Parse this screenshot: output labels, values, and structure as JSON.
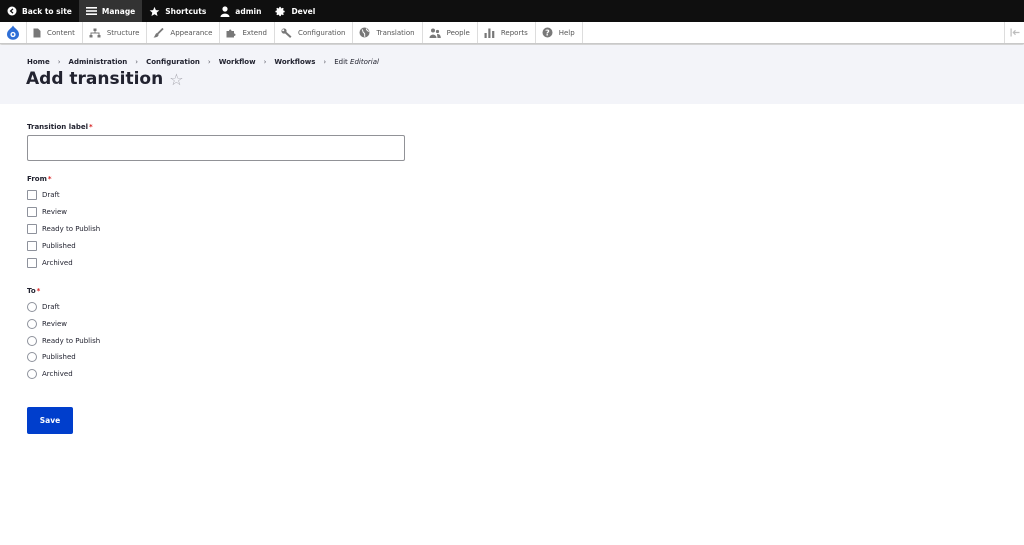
{
  "toolbar": {
    "back_to_site": "Back to site",
    "manage": "Manage",
    "shortcuts": "Shortcuts",
    "user": "admin",
    "devel": "Devel"
  },
  "tray": {
    "items": [
      "Content",
      "Structure",
      "Appearance",
      "Extend",
      "Configuration",
      "Translation",
      "People",
      "Reports",
      "Help"
    ]
  },
  "breadcrumb": {
    "items": [
      "Home",
      "Administration",
      "Configuration",
      "Workflow",
      "Workflows"
    ],
    "last_prefix": "Edit",
    "last_emphasis": "Editorial",
    "separator": "›"
  },
  "page": {
    "title": "Add transition",
    "star": "☆"
  },
  "form": {
    "transition_label": "Transition label",
    "required_mark": "*",
    "transition_value": "",
    "from_label": "From",
    "from_options": [
      "Draft",
      "Review",
      "Ready to Publish",
      "Published",
      "Archived"
    ],
    "to_label": "To",
    "to_options": [
      "Draft",
      "Review",
      "Ready to Publish",
      "Published",
      "Archived"
    ],
    "save": "Save"
  },
  "colors": {
    "primary": "#003ecc",
    "required": "#d72222",
    "toolbar_bg": "#0f0f0f",
    "header_bg": "#f3f4f9"
  }
}
